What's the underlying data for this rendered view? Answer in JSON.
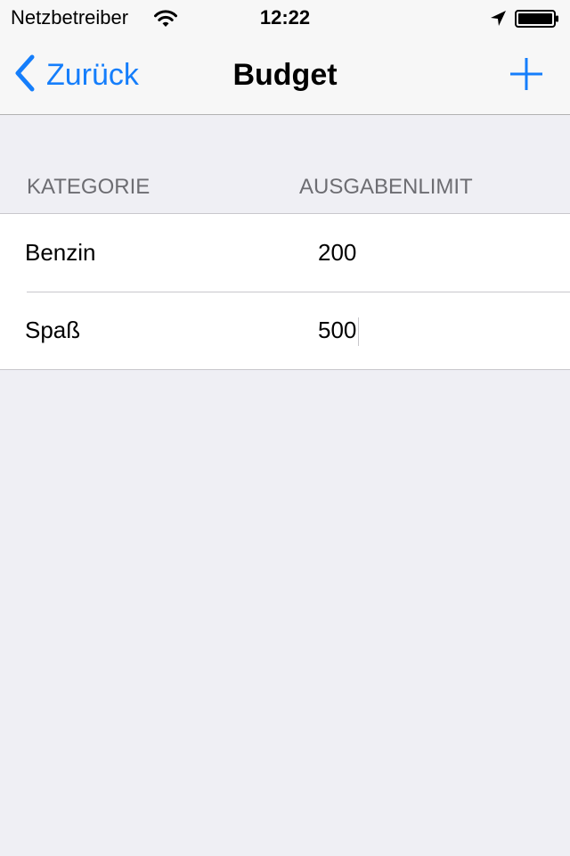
{
  "status_bar": {
    "carrier": "Netzbetreiber",
    "time": "12:22",
    "icons": [
      "wifi-icon",
      "location-arrow-icon",
      "battery-icon"
    ]
  },
  "nav": {
    "back_label": "Zurück",
    "title": "Budget",
    "back_icon": "chevron-left-icon",
    "add_icon": "plus-icon"
  },
  "table": {
    "columns": [
      "KATEGORIE",
      "AUSGABENLIMIT"
    ],
    "rows": [
      {
        "category": "Benzin",
        "limit": "200"
      },
      {
        "category": "Spaß",
        "limit": "500"
      }
    ]
  },
  "colors": {
    "accent": "#157efb",
    "background": "#efeff4",
    "header_text": "#6d6d72",
    "separator": "#c8c7cc"
  }
}
